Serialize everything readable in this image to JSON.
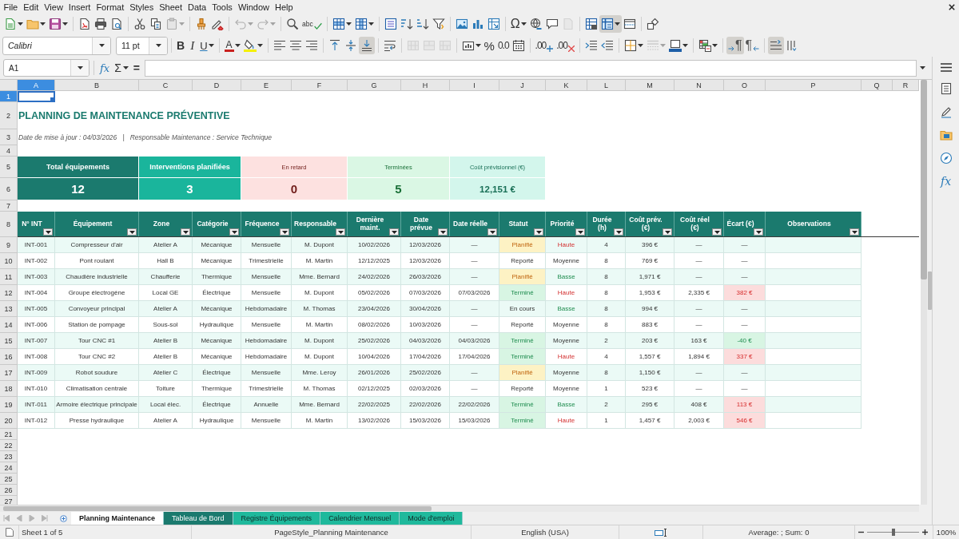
{
  "menu_bar": [
    "File",
    "Edit",
    "View",
    "Insert",
    "Format",
    "Styles",
    "Sheet",
    "Data",
    "Tools",
    "Window",
    "Help"
  ],
  "standard_toolbar": {
    "groups": [
      [
        {
          "kind": "new",
          "pressed": false,
          "disabled": false
        },
        {
          "kind": "open",
          "pressed": false,
          "disabled": false
        },
        {
          "kind": "save",
          "pressed": false,
          "disabled": false
        }
      ],
      [
        {
          "kind": "export_pdf",
          "pressed": false,
          "disabled": false
        },
        {
          "kind": "print",
          "pressed": false,
          "disabled": false
        },
        {
          "kind": "print_preview",
          "pressed": false,
          "disabled": false
        }
      ],
      [
        {
          "kind": "cut",
          "pressed": false,
          "disabled": false
        },
        {
          "kind": "copy",
          "pressed": false,
          "disabled": false
        },
        {
          "kind": "paste",
          "pressed": false,
          "disabled": true
        }
      ],
      [
        {
          "kind": "clone_formatting",
          "pressed": false,
          "disabled": false
        },
        {
          "kind": "clear_formatting",
          "pressed": false,
          "disabled": false
        }
      ],
      [
        {
          "kind": "undo",
          "pressed": false,
          "disabled": true
        },
        {
          "kind": "redo",
          "pressed": false,
          "disabled": true
        }
      ],
      [
        {
          "kind": "find_replace",
          "pressed": false,
          "disabled": false
        },
        {
          "kind": "spelling",
          "glyph": "abc",
          "pressed": false,
          "disabled": false
        }
      ],
      [
        {
          "kind": "row",
          "pressed": false,
          "disabled": false
        },
        {
          "kind": "column",
          "pressed": false,
          "disabled": false
        }
      ],
      [
        {
          "kind": "sort",
          "pressed": false,
          "disabled": false
        },
        {
          "kind": "sort_ascending",
          "pressed": false,
          "disabled": false
        },
        {
          "kind": "sort_descending",
          "pressed": false,
          "disabled": false
        },
        {
          "kind": "autofilter",
          "pressed": false,
          "disabled": false
        }
      ],
      [
        {
          "kind": "image",
          "pressed": false,
          "disabled": false
        },
        {
          "kind": "chart",
          "pressed": false,
          "disabled": false
        },
        {
          "kind": "pivot_table",
          "pressed": false,
          "disabled": false
        }
      ],
      [
        {
          "kind": "special_character",
          "glyph": "Ω",
          "pressed": false,
          "disabled": false
        },
        {
          "kind": "hyperlink",
          "pressed": false,
          "disabled": false
        },
        {
          "kind": "comment",
          "pressed": false,
          "disabled": false
        },
        {
          "kind": "header_footer",
          "pressed": false,
          "disabled": true
        }
      ],
      [
        {
          "kind": "print_area",
          "pressed": false,
          "disabled": false
        },
        {
          "kind": "freeze",
          "pressed": true,
          "disabled": false
        },
        {
          "kind": "split_window",
          "pressed": false,
          "disabled": false
        }
      ],
      [
        {
          "kind": "draw_functions",
          "pressed": false,
          "disabled": false
        }
      ]
    ]
  },
  "formatting_toolbar": {
    "font_name": "Calibri",
    "font_size": "11 pt",
    "groups": [
      [
        {
          "kind": "bold",
          "glyph": "B",
          "pressed": false,
          "disabled": false
        },
        {
          "kind": "italic",
          "glyph": "I",
          "pressed": false,
          "disabled": false
        },
        {
          "kind": "underline",
          "glyph": "U",
          "pressed": false,
          "disabled": false
        }
      ],
      [
        {
          "kind": "font_color",
          "glyph": "A",
          "pressed": false,
          "disabled": false
        },
        {
          "kind": "highlight",
          "pressed": false,
          "disabled": false
        }
      ],
      [
        {
          "kind": "align_left",
          "pressed": false,
          "disabled": false
        },
        {
          "kind": "align_center",
          "pressed": false,
          "disabled": false
        },
        {
          "kind": "align_right",
          "pressed": false,
          "disabled": false
        }
      ],
      [
        {
          "kind": "align_top",
          "pressed": false,
          "disabled": false
        },
        {
          "kind": "align_middle",
          "pressed": false,
          "disabled": false
        },
        {
          "kind": "align_bottom",
          "pressed": true,
          "disabled": false
        }
      ],
      [
        {
          "kind": "wrap_text",
          "pressed": false,
          "disabled": false
        }
      ],
      [
        {
          "kind": "merge_center",
          "pressed": false,
          "disabled": true
        },
        {
          "kind": "merge",
          "pressed": false,
          "disabled": true
        },
        {
          "kind": "unmerge",
          "pressed": false,
          "disabled": true
        }
      ],
      [
        {
          "kind": "number_format",
          "pressed": false,
          "disabled": false
        },
        {
          "kind": "percent",
          "glyph": "%",
          "pressed": false,
          "disabled": false
        },
        {
          "kind": "decimal",
          "glyph": "0.0",
          "pressed": false,
          "disabled": false
        },
        {
          "kind": "date",
          "pressed": false,
          "disabled": false
        }
      ],
      [
        {
          "kind": "add_decimal",
          "glyph": ".00",
          "pressed": false,
          "disabled": false
        },
        {
          "kind": "delete_decimal",
          "glyph": ".00",
          "pressed": false,
          "disabled": false
        }
      ],
      [
        {
          "kind": "increase_indent",
          "pressed": false,
          "disabled": false
        },
        {
          "kind": "decrease_indent",
          "pressed": false,
          "disabled": false
        }
      ],
      [
        {
          "kind": "borders",
          "pressed": false,
          "disabled": false
        },
        {
          "kind": "border_style",
          "pressed": false,
          "disabled": true
        },
        {
          "kind": "border_color",
          "pressed": false,
          "disabled": false
        }
      ],
      [
        {
          "kind": "conditional",
          "pressed": false,
          "disabled": false
        }
      ],
      [
        {
          "kind": "paragraph_ltr",
          "glyph": "¶",
          "pressed": true,
          "disabled": false
        },
        {
          "kind": "paragraph_rtl",
          "glyph": "¶",
          "pressed": false,
          "disabled": false
        }
      ],
      [
        {
          "kind": "text_horizontal",
          "pressed": true,
          "disabled": false
        },
        {
          "kind": "text_vertical",
          "pressed": false,
          "disabled": false
        }
      ]
    ]
  },
  "formula_bar": {
    "name_box": "A1",
    "buttons": [
      {
        "kind": "function_wizard",
        "glyph": "fx"
      },
      {
        "kind": "sum",
        "glyph": "Σ"
      },
      {
        "kind": "formula",
        "glyph": "="
      }
    ]
  },
  "sidebar": {
    "tabs": [
      {
        "kind": "properties",
        "selected": false
      },
      {
        "kind": "styles",
        "selected": false
      },
      {
        "kind": "gallery",
        "selected": false
      },
      {
        "kind": "navigator",
        "selected": false
      },
      {
        "kind": "functions",
        "glyph": "fx",
        "selected": false
      }
    ]
  },
  "sheet": {
    "columns": [
      {
        "label": "A",
        "selected": true
      },
      {
        "label": "B",
        "selected": false
      },
      {
        "label": "C",
        "selected": false
      },
      {
        "label": "D",
        "selected": false
      },
      {
        "label": "E",
        "selected": false
      },
      {
        "label": "F",
        "selected": false
      },
      {
        "label": "G",
        "selected": false
      },
      {
        "label": "H",
        "selected": false
      },
      {
        "label": "I",
        "selected": false
      },
      {
        "label": "J",
        "selected": false
      },
      {
        "label": "K",
        "selected": false
      },
      {
        "label": "L",
        "selected": false
      },
      {
        "label": "M",
        "selected": false
      },
      {
        "label": "N",
        "selected": false
      },
      {
        "label": "O",
        "selected": false
      },
      {
        "label": "P",
        "selected": false
      },
      {
        "label": "Q",
        "selected": false
      },
      {
        "label": "R",
        "selected": false
      }
    ],
    "rows": [
      {
        "label": "1",
        "selected": true
      },
      {
        "label": "2",
        "selected": false
      },
      {
        "label": "3",
        "selected": false
      },
      {
        "label": "4",
        "selected": false
      },
      {
        "label": "5",
        "selected": false
      },
      {
        "label": "6",
        "selected": false
      },
      {
        "label": "7",
        "selected": false
      },
      {
        "label": "8",
        "selected": false
      },
      {
        "label": "9",
        "selected": false
      },
      {
        "label": "10",
        "selected": false
      },
      {
        "label": "11",
        "selected": false
      },
      {
        "label": "12",
        "selected": false
      },
      {
        "label": "13",
        "selected": false
      },
      {
        "label": "14",
        "selected": false
      },
      {
        "label": "15",
        "selected": false
      },
      {
        "label": "16",
        "selected": false
      },
      {
        "label": "17",
        "selected": false
      },
      {
        "label": "18",
        "selected": false
      },
      {
        "label": "19",
        "selected": false
      },
      {
        "label": "20",
        "selected": false
      },
      {
        "label": "21",
        "selected": false
      },
      {
        "label": "22",
        "selected": false
      },
      {
        "label": "23",
        "selected": false
      },
      {
        "label": "24",
        "selected": false
      },
      {
        "label": "25",
        "selected": false
      },
      {
        "label": "26",
        "selected": false
      },
      {
        "label": "27",
        "selected": false
      }
    ],
    "title": "PLANNING DE MAINTENANCE PRÉVENTIVE",
    "subtitle": "Date de mise à jour : 04/03/2026   |   Responsable Maintenance : Service Technique",
    "kpis": [
      {
        "label": "Total équipements",
        "value": "12",
        "kind": "count",
        "color": "#1b7a6e"
      },
      {
        "label": "Interventions planifiées",
        "value": "3",
        "kind": "count",
        "color": "#1ab59c"
      },
      {
        "label": "En retard",
        "value": "0",
        "kind": "count",
        "color": "#fde1e0"
      },
      {
        "label": "Terminées",
        "value": "5",
        "kind": "count",
        "color": "#daf7e4"
      },
      {
        "label": "Coût prévisionnel (€)",
        "value": "12,151 €",
        "kind": "amount",
        "color": "#d3f6ec"
      }
    ],
    "table": {
      "columns": [
        "N° INT",
        "Équipement",
        "Zone",
        "Catégorie",
        "Fréquence",
        "Responsable",
        "Dernière maint.",
        "Date prévue",
        "Date réelle",
        "Statut",
        "Priorité",
        "Durée (h)",
        "Coût prév. (€)",
        "Coût réel (€)",
        "Écart (€)",
        "Observations"
      ],
      "rows": [
        {
          "cells": [
            "INT-001",
            "Compresseur d'air",
            "Atelier A",
            "Mécanique",
            "Mensuelle",
            "M. Dupont",
            "10/02/2026",
            "12/03/2026",
            "—",
            {
              "text": "Planifié",
              "kind": "planned"
            },
            {
              "text": "Haute",
              "kind": "high"
            },
            "4",
            "396 €",
            "—",
            "—"
          ]
        },
        {
          "cells": [
            "INT-002",
            "Pont roulant",
            "Hall B",
            "Mécanique",
            "Trimestrielle",
            "M. Martin",
            "12/12/2025",
            "12/03/2026",
            "—",
            "Reporté",
            "Moyenne",
            "8",
            "769 €",
            "—",
            "—"
          ]
        },
        {
          "cells": [
            "INT-003",
            "Chaudière industrielle",
            "Chaufferie",
            "Thermique",
            "Mensuelle",
            "Mme. Bernard",
            "24/02/2026",
            "26/03/2026",
            "—",
            {
              "text": "Planifié",
              "kind": "planned"
            },
            {
              "text": "Basse",
              "kind": "low"
            },
            "8",
            "1,971 €",
            "—",
            "—"
          ]
        },
        {
          "cells": [
            "INT-004",
            "Groupe électrogène",
            "Local GE",
            "Électrique",
            "Mensuelle",
            "M. Dupont",
            "05/02/2026",
            "07/03/2026",
            "07/03/2026",
            {
              "text": "Terminé",
              "kind": "done"
            },
            {
              "text": "Haute",
              "kind": "high"
            },
            "8",
            "1,953 €",
            "2,335 €",
            {
              "text": "382 €",
              "kind": "over"
            }
          ]
        },
        {
          "cells": [
            "INT-005",
            "Convoyeur principal",
            "Atelier A",
            "Mécanique",
            "Hebdomadaire",
            "M. Thomas",
            "23/04/2026",
            "30/04/2026",
            "—",
            "En cours",
            {
              "text": "Basse",
              "kind": "low"
            },
            "8",
            "994 €",
            "—",
            "—"
          ]
        },
        {
          "cells": [
            "INT-006",
            "Station de pompage",
            "Sous-sol",
            "Hydraulique",
            "Mensuelle",
            "M. Martin",
            "08/02/2026",
            "10/03/2026",
            "—",
            "Reporté",
            "Moyenne",
            "8",
            "883 €",
            "—",
            "—"
          ]
        },
        {
          "cells": [
            "INT-007",
            "Tour CNC #1",
            "Atelier B",
            "Mécanique",
            "Hebdomadaire",
            "M. Dupont",
            "25/02/2026",
            "04/03/2026",
            "04/03/2026",
            {
              "text": "Terminé",
              "kind": "done"
            },
            "Moyenne",
            "2",
            "203 €",
            "163 €",
            {
              "text": "-40 €",
              "kind": "under"
            }
          ]
        },
        {
          "cells": [
            "INT-008",
            "Tour CNC #2",
            "Atelier B",
            "Mécanique",
            "Hebdomadaire",
            "M. Dupont",
            "10/04/2026",
            "17/04/2026",
            "17/04/2026",
            {
              "text": "Terminé",
              "kind": "done"
            },
            {
              "text": "Haute",
              "kind": "high"
            },
            "4",
            "1,557 €",
            "1,894 €",
            {
              "text": "337 €",
              "kind": "over"
            }
          ]
        },
        {
          "cells": [
            "INT-009",
            "Robot soudure",
            "Atelier C",
            "Électrique",
            "Mensuelle",
            "Mme. Leroy",
            "26/01/2026",
            "25/02/2026",
            "—",
            {
              "text": "Planifié",
              "kind": "planned"
            },
            "Moyenne",
            "8",
            "1,150 €",
            "—",
            "—"
          ]
        },
        {
          "cells": [
            "INT-010",
            "Climatisation centrale",
            "Toiture",
            "Thermique",
            "Trimestrielle",
            "M. Thomas",
            "02/12/2025",
            "02/03/2026",
            "—",
            "Reporté",
            "Moyenne",
            "1",
            "523 €",
            "—",
            "—"
          ]
        },
        {
          "cells": [
            "INT-011",
            "Armoire électrique principale",
            "Local élec.",
            "Électrique",
            "Annuelle",
            "Mme. Bernard",
            "22/02/2025",
            "22/02/2026",
            "22/02/2026",
            {
              "text": "Terminé",
              "kind": "done"
            },
            {
              "text": "Basse",
              "kind": "low"
            },
            "2",
            "295 €",
            "408 €",
            {
              "text": "113 €",
              "kind": "over"
            }
          ]
        },
        {
          "cells": [
            "INT-012",
            "Presse hydraulique",
            "Atelier A",
            "Hydraulique",
            "Mensuelle",
            "M. Martin",
            "13/02/2026",
            "15/03/2026",
            "15/03/2026",
            {
              "text": "Terminé",
              "kind": "done"
            },
            {
              "text": "Haute",
              "kind": "high"
            },
            "1",
            "1,457 €",
            "2,003 €",
            {
              "text": "546 €",
              "kind": "over"
            }
          ]
        }
      ]
    }
  },
  "sheet_tabs": {
    "navigation": [
      {
        "kind": "first",
        "disabled": true
      },
      {
        "kind": "previous",
        "disabled": true
      },
      {
        "kind": "next",
        "disabled": true
      },
      {
        "kind": "last",
        "disabled": true
      }
    ],
    "tabs": [
      {
        "label": "Planning Maintenance",
        "selected": true
      },
      {
        "label": "Tableau de Bord",
        "selected": false,
        "color": "#1b7a6e"
      },
      {
        "label": "Registre Équipements",
        "selected": false,
        "color": "#1fb99c"
      },
      {
        "label": "Calendrier Mensuel",
        "selected": false,
        "color": "#1fb99c"
      },
      {
        "label": "Mode d'emploi",
        "selected": false,
        "color": "#1fb99c"
      }
    ]
  },
  "status_bar": {
    "sheet": "Sheet 1 of 5",
    "page_style": "PageStyle_Planning Maintenance",
    "language": "English (USA)",
    "summary": "Average: ; Sum: 0",
    "zoom_slider": {
      "level": 0.5
    },
    "zoom": "100%"
  }
}
